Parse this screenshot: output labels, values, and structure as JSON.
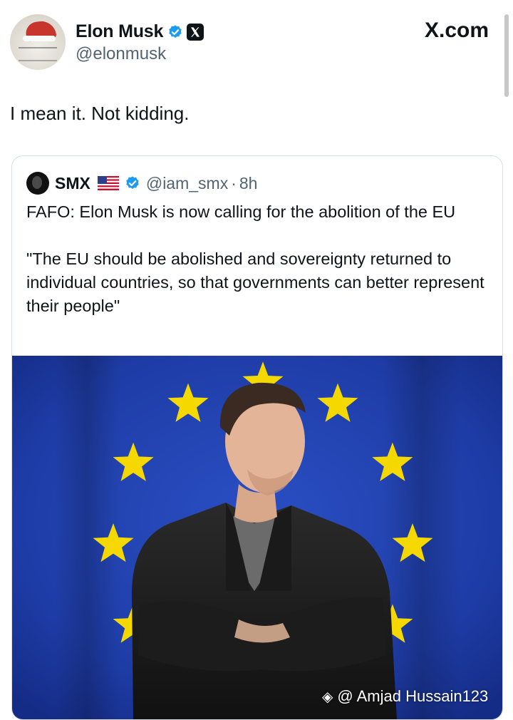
{
  "site": "X.com",
  "author": {
    "name": "Elon Musk",
    "handle": "@elonmusk"
  },
  "tweet": {
    "text": "I mean it. Not kidding."
  },
  "quote": {
    "name": "SMX",
    "flag": "us-flag",
    "handle": "@iam_smx",
    "separator": "·",
    "time": "8h",
    "line1": "FAFO: Elon Musk is now calling for the abolition of the EU",
    "line2": "\"The EU should be abolished and sovereignty returned to individual countries, so that governments can better represent their people\""
  },
  "watermark": "@ Amjad Hussain123",
  "icons": [
    "verified-badge-icon",
    "x-logo-icon",
    "us-flag-icon",
    "binance-logo-icon"
  ],
  "colors": {
    "verified": "#1d9bf0",
    "eu_blue": "#1f3fa8",
    "eu_star": "#f5d800"
  }
}
